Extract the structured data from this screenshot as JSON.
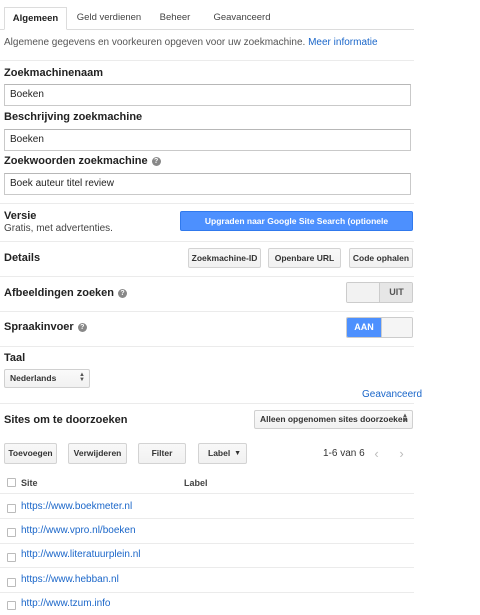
{
  "tabs": [
    {
      "label": "Algemeen",
      "active": true
    },
    {
      "label": "Geld verdienen",
      "active": false
    },
    {
      "label": "Beheer",
      "active": false
    },
    {
      "label": "Geavanceerd",
      "active": false
    }
  ],
  "intro": {
    "text": "Algemene gegevens en voorkeuren opgeven voor uw zoekmachine.",
    "link": "Meer informatie"
  },
  "fields": {
    "name_label": "Zoekmachinenaam",
    "name_value": "Boeken",
    "description_label": "Beschrijving zoekmachine",
    "description_value": "Boeken",
    "keywords_label": "Zoekwoorden zoekmachine",
    "keywords_value": "Boek auteur titel review"
  },
  "version": {
    "label": "Versie",
    "value": "Gratis, met advertenties.",
    "upgrade_button": "Upgraden naar Google Site Search (optionele advertenties)"
  },
  "details": {
    "label": "Details",
    "buttons": [
      "Zoekmachine-ID",
      "Openbare URL",
      "Code ophalen"
    ]
  },
  "image_search": {
    "label": "Afbeeldingen zoeken",
    "state": "UIT",
    "on": false
  },
  "speech_input": {
    "label": "Spraakinvoer",
    "state": "AAN",
    "on": true
  },
  "language": {
    "label": "Taal",
    "selected": "Nederlands"
  },
  "advanced_link": "Geavanceerd",
  "sites": {
    "label": "Sites om te doorzoeken",
    "filter_select": "Alleen opgenomen sites doorzoeken",
    "toolbar": {
      "add": "Toevoegen",
      "remove": "Verwijderen",
      "filter": "Filter",
      "label": "Label"
    },
    "pager": "1-6 van 6",
    "columns": {
      "site": "Site",
      "label": "Label"
    },
    "rows": [
      "https://www.boekmeter.nl",
      "http://www.vpro.nl/boeken",
      "http://www.literatuurplein.nl",
      "https://www.hebban.nl",
      "http://www.tzum.info"
    ]
  },
  "icons": {
    "help": "help-icon",
    "prev": "chevron-left-icon",
    "next": "chevron-right-icon",
    "dropdown": "dropdown-arrow-icon"
  },
  "colors": {
    "accent": "#4d90fe",
    "link": "#1a66c9"
  }
}
